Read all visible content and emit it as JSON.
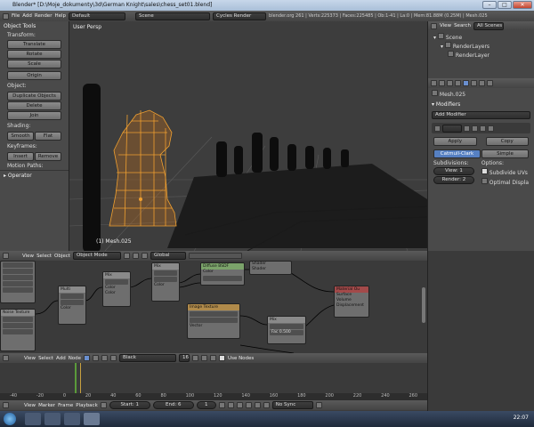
{
  "title": "Blender* [D:\\Moje_dokumenty\\3d\\German Knight\\sales\\chess_set01.blend]",
  "win_buttons": [
    "–",
    "□",
    "✕"
  ],
  "menu": [
    "File",
    "Add",
    "Render",
    "Help"
  ],
  "layout": "Default",
  "scene": "Scene",
  "engine": "Cycles Render",
  "stats": "blender.org 261 | Verts:225373 | Faces:225485 | Ob:1-41 | La:0 | Mem:81.88M (0.25M) | Mesh.025",
  "tools": {
    "header": "Object Tools",
    "transform": "Transform:",
    "translate": "Translate",
    "rotate": "Rotate",
    "scale": "Scale",
    "origin": "Origin",
    "object": "Object:",
    "duplicate": "Duplicate Objects",
    "delete": "Delete",
    "join": "Join",
    "shading": "Shading:",
    "smooth": "Smooth",
    "flat": "Flat",
    "keyframes": "Keyframes:",
    "insert": "Insert",
    "remove": "Remove",
    "motion": "Motion Paths:",
    "operator": "Operator"
  },
  "viewport": {
    "label": "User Persp",
    "object_label": "(1) Mesh.025",
    "view": "View",
    "select": "Select",
    "object": "Object",
    "mode": "Object Mode",
    "pivot": "Global"
  },
  "outliner": {
    "view": "View",
    "search": "Search",
    "filter": "All Scenes",
    "scene": "Scene",
    "render_layers": "RenderLayers",
    "render_layer": "RenderLayer"
  },
  "props": {
    "object": "Mesh.025",
    "modifiers": "Modifiers",
    "add_modifier": "Add Modifier",
    "apply": "Apply",
    "copy": "Copy",
    "catmull": "Catmull-Clark",
    "simple": "Simple",
    "subdivisions": "Subdivisions:",
    "options": "Options:",
    "view": "View: 1",
    "render": "Render: 2",
    "subdivide_uvs": "Subdivide UVs",
    "optimal": "Optimal Displa"
  },
  "nodes": {
    "view": "View",
    "select": "Select",
    "add": "Add",
    "node": "Node",
    "material": "Black",
    "users": "16",
    "use_nodes": "Use Nodes",
    "diffuse": "Diffuse BSDF",
    "image": "Image Texture",
    "mix1": "Mix",
    "mix2": "Mix",
    "mix3": "Mix",
    "multiply": "Multi",
    "output": "Material Ou",
    "noise": "Noise Texture",
    "fac_val": "Fac 0.500"
  },
  "timeline": {
    "ticks": [
      "-40",
      "-20",
      "0",
      "20",
      "40",
      "60",
      "80",
      "100",
      "120",
      "140",
      "160",
      "180",
      "200",
      "220",
      "240",
      "260"
    ],
    "view": "View",
    "marker": "Marker",
    "frame": "Frame",
    "playback": "Playback",
    "start": "Start: 1",
    "end": "End: 6",
    "current": "1",
    "sync": "No Sync"
  },
  "taskbar": {
    "clock": "22:07"
  }
}
